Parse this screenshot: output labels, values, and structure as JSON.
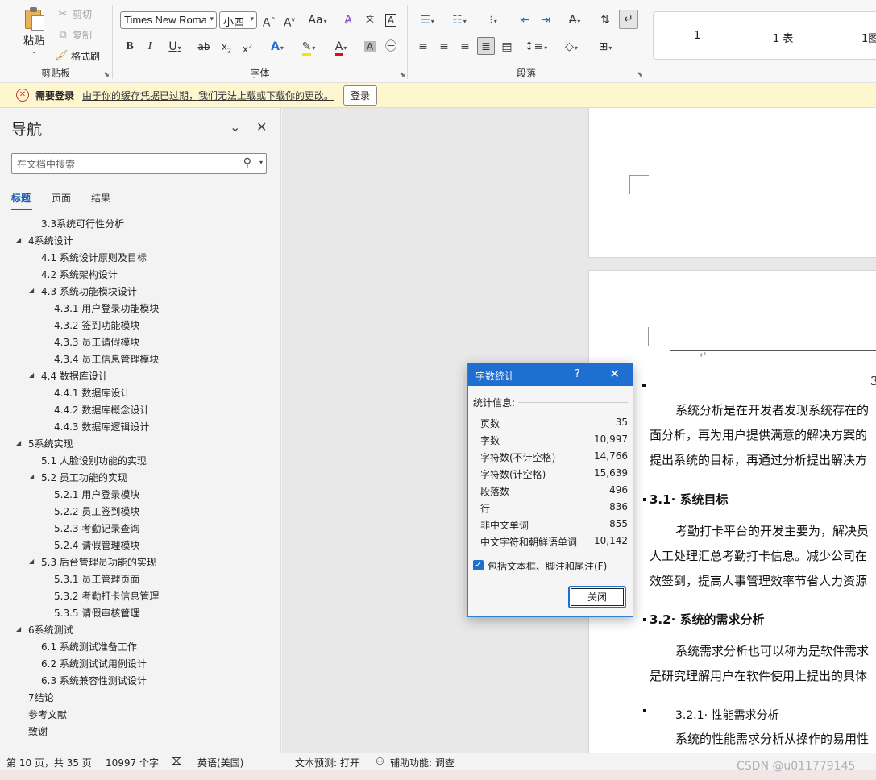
{
  "ribbon": {
    "clipboard": {
      "paste": "粘贴",
      "cut": "剪切",
      "copy": "复制",
      "format_painter": "格式刷",
      "label": "剪贴板"
    },
    "font": {
      "name": "Times New Roma",
      "size": "小四",
      "label": "字体",
      "case": "Aa"
    },
    "paragraph": {
      "label": "段落"
    },
    "styles": [
      "1",
      "1 表",
      "1图"
    ]
  },
  "message_bar": {
    "title": "需要登录",
    "text": "由于你的缓存凭据已过期，我们无法上载或下载你的更改。",
    "button": "登录"
  },
  "nav": {
    "title": "导航",
    "search_placeholder": "在文档中搜索",
    "tabs": [
      "标题",
      "页面",
      "结果"
    ],
    "outline": [
      {
        "text": "3.3系统可行性分析"
      },
      {
        "text": "4系统设计"
      },
      {
        "text": "4.1 系统设计原则及目标"
      },
      {
        "text": "4.2 系统架构设计"
      },
      {
        "text": "4.3 系统功能模块设计"
      },
      {
        "text": "4.3.1 用户登录功能模块"
      },
      {
        "text": "4.3.2 签到功能模块"
      },
      {
        "text": "4.3.3 员工请假模块"
      },
      {
        "text": "4.3.4 员工信息管理模块"
      },
      {
        "text": "4.4 数据库设计"
      },
      {
        "text": "4.4.1 数据库设计"
      },
      {
        "text": "4.4.2 数据库概念设计"
      },
      {
        "text": "4.4.3 数据库逻辑设计"
      },
      {
        "text": "5系统实现"
      },
      {
        "text": "5.1 人脸设别功能的实现"
      },
      {
        "text": "5.2 员工功能的实现"
      },
      {
        "text": "5.2.1 用户登录模块"
      },
      {
        "text": "5.2.2 员工签到模块"
      },
      {
        "text": "5.2.3 考勤记录查询"
      },
      {
        "text": "5.2.4 请假管理模块"
      },
      {
        "text": "5.3 后台管理员功能的实现"
      },
      {
        "text": "5.3.1 员工管理页面"
      },
      {
        "text": "5.3.2 考勤打卡信息管理"
      },
      {
        "text": "5.3.5 请假审核管理"
      },
      {
        "text": "6系统测试"
      },
      {
        "text": "6.1 系统测试准备工作"
      },
      {
        "text": "6.2 系统测试试用例设计"
      },
      {
        "text": "6.3 系统兼容性测试设计"
      },
      {
        "text": "7结论"
      },
      {
        "text": "参考文献"
      },
      {
        "text": "致谢"
      }
    ]
  },
  "document": {
    "page_number": "3",
    "lines": [
      "系统分析是在开发者发现系统存在的",
      "面分析，再为用户提供满意的解决方案的",
      "提出系统的目标，再通过分析提出解决方"
    ],
    "h_31": "3.1· 系统目标",
    "lines_31": [
      "考勤打卡平台的开发主要为，解决员",
      "人工处理汇总考勤打卡信息。减少公司在",
      "效签到，提高人事管理效率节省人力资源"
    ],
    "h_32": "3.2· 系统的需求分析",
    "lines_32": [
      "系统需求分析也可以称为是软件需求",
      "是研究理解用户在软件使用上提出的具体"
    ],
    "h_321": "3.2.1· 性能需求分析",
    "line_321": "系统的性能需求分析从操作的易用性"
  },
  "dialog": {
    "title": "字数统计",
    "help": "?",
    "section": "统计信息:",
    "stats": [
      {
        "label": "页数",
        "value": "35"
      },
      {
        "label": "字数",
        "value": "10,997"
      },
      {
        "label": "字符数(不计空格)",
        "value": "14,766"
      },
      {
        "label": "字符数(计空格)",
        "value": "15,639"
      },
      {
        "label": "段落数",
        "value": "496"
      },
      {
        "label": "行",
        "value": "836"
      },
      {
        "label": "非中文单词",
        "value": "855"
      },
      {
        "label": "中文字符和朝鲜语单词",
        "value": "10,142"
      }
    ],
    "checkbox_label": "包括文本框、脚注和尾注(F)",
    "checkbox_checked": true,
    "close_button": "关闭"
  },
  "status": {
    "page": "第 10 页，共 35 页",
    "words": "10997 个字",
    "language": "英语(美国)",
    "prediction": "文本预测: 打开",
    "accessibility": "辅助功能: 调查"
  },
  "watermark": "CSDN @u011779145"
}
